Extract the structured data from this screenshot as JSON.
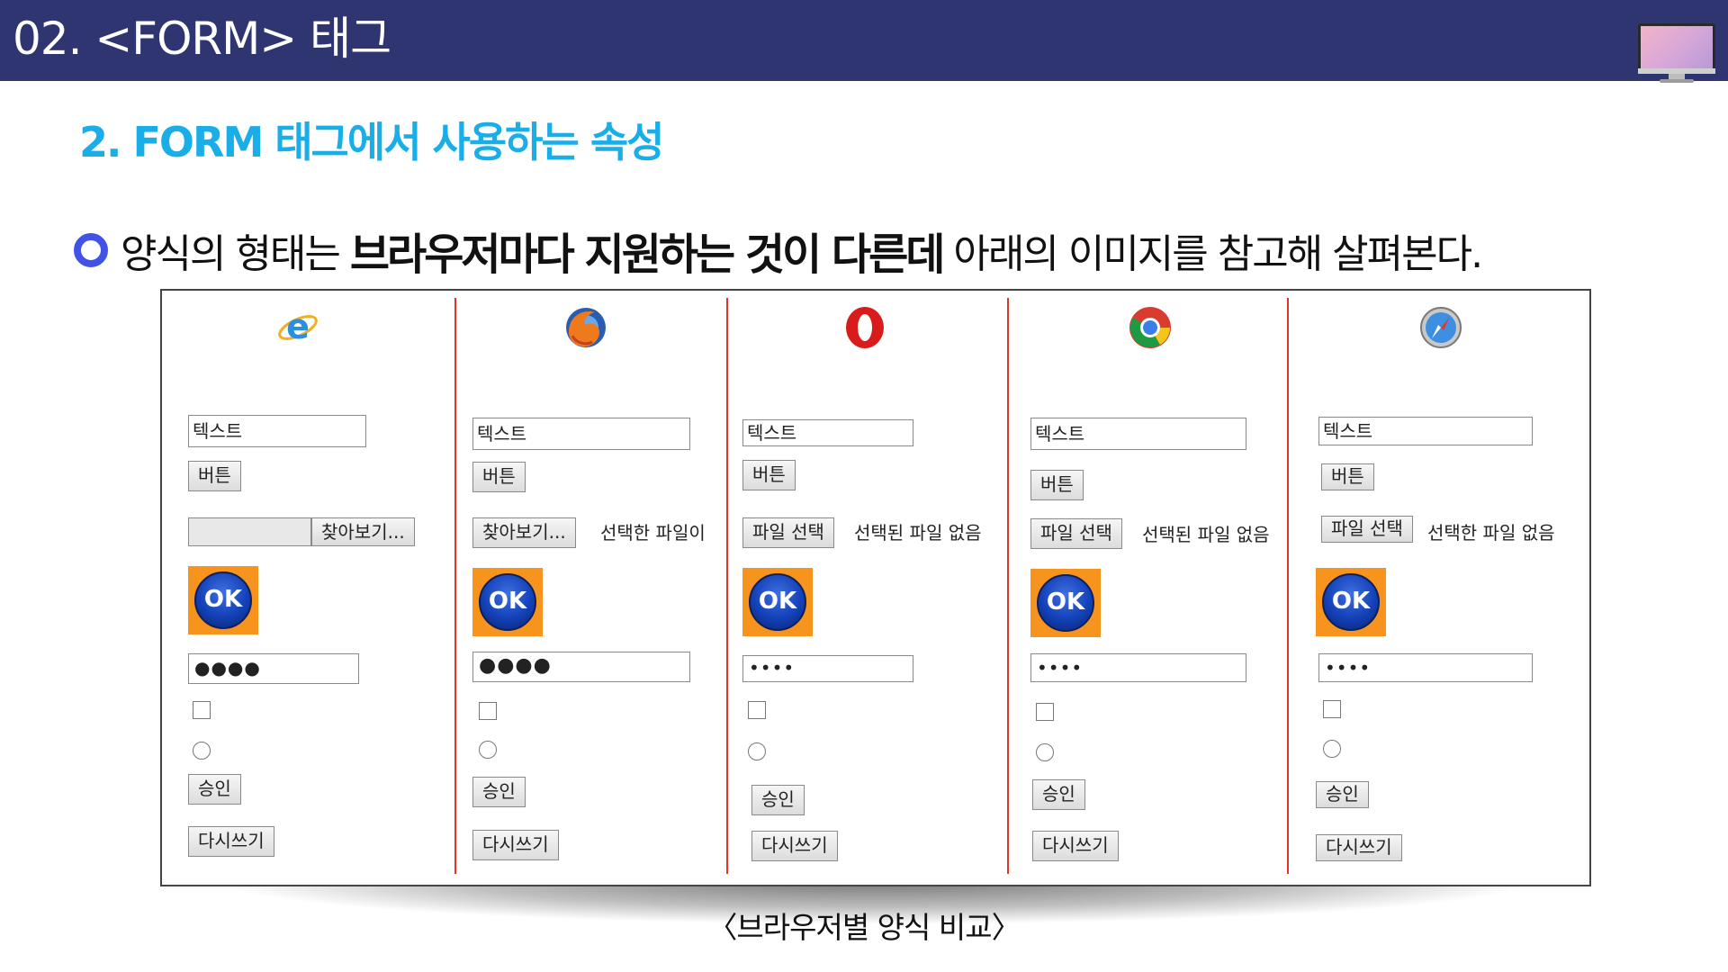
{
  "header": {
    "title": "02. <FORM> 태그"
  },
  "subtitle": "2. FORM 태그에서 사용하는 속성",
  "bullet": {
    "text_before": "양식의 형태는",
    "text_bold": "브라우저마다 지원하는 것이 다른데",
    "text_after": "아래의 이미지를 참고해 살펴본다."
  },
  "figure": {
    "caption": "〈브라우저별 양식 비교〉",
    "browsers": [
      {
        "icon": "internet-explorer-icon",
        "text": "텍스트",
        "button": "버튼",
        "file_button": "찾아보기...",
        "file_status": "",
        "ok": "OK",
        "password": "●●●●",
        "submit": "승인",
        "reset": "다시쓰기"
      },
      {
        "icon": "firefox-icon",
        "text": "텍스트",
        "button": "버튼",
        "file_button": "찾아보기...",
        "file_status": "선택한 파일이",
        "ok": "OK",
        "password": "●●●●",
        "submit": "승인",
        "reset": "다시쓰기"
      },
      {
        "icon": "opera-icon",
        "text": "텍스트",
        "button": "버튼",
        "file_button": "파일 선택",
        "file_status": "선택된 파일 없음",
        "ok": "OK",
        "password": "••••",
        "submit": "승인",
        "reset": "다시쓰기"
      },
      {
        "icon": "chrome-icon",
        "text": "텍스트",
        "button": "버튼",
        "file_button": "파일 선택",
        "file_status": "선택된 파일 없음",
        "ok": "OK",
        "password": "••••",
        "submit": "승인",
        "reset": "다시쓰기"
      },
      {
        "icon": "safari-icon",
        "text": "텍스트",
        "button": "버튼",
        "file_button": "파일 선택",
        "file_status": "선택한 파일 없음",
        "ok": "OK",
        "password": "••••",
        "submit": "승인",
        "reset": "다시쓰기"
      }
    ]
  },
  "colors": {
    "header_bg": "#2e3570",
    "subtitle": "#1aaee8",
    "bullet": "#4352e6",
    "divider": "#e0352b",
    "ok_bg": "#f7941d"
  }
}
